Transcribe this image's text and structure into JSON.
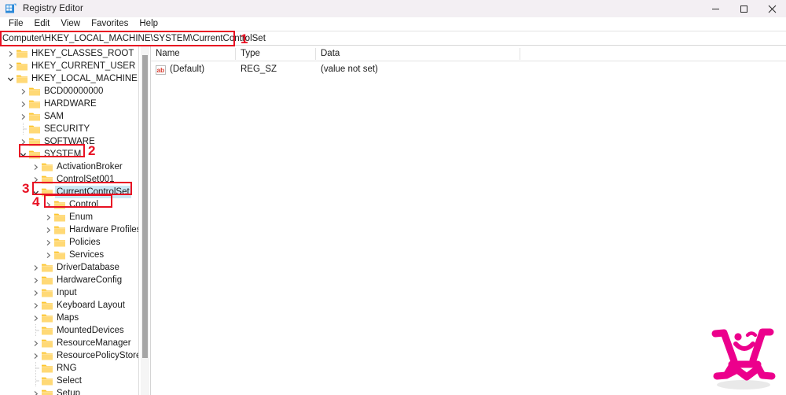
{
  "window": {
    "title": "Registry Editor",
    "icon": "registry-editor-icon",
    "controls": {
      "minimize": "minimize-icon",
      "maximize": "maximize-icon",
      "close": "close-icon"
    }
  },
  "menu": {
    "items": [
      "File",
      "Edit",
      "View",
      "Favorites",
      "Help"
    ]
  },
  "address": {
    "value": "Computer\\HKEY_LOCAL_MACHINE\\SYSTEM\\CurrentControlSet"
  },
  "tree": {
    "items": [
      {
        "label": "HKEY_CLASSES_ROOT",
        "depth": 1,
        "state": "collapsed",
        "selected": false
      },
      {
        "label": "HKEY_CURRENT_USER",
        "depth": 1,
        "state": "collapsed",
        "selected": false
      },
      {
        "label": "HKEY_LOCAL_MACHINE",
        "depth": 1,
        "state": "expanded",
        "selected": false
      },
      {
        "label": "BCD00000000",
        "depth": 2,
        "state": "collapsed",
        "selected": false
      },
      {
        "label": "HARDWARE",
        "depth": 2,
        "state": "collapsed",
        "selected": false
      },
      {
        "label": "SAM",
        "depth": 2,
        "state": "collapsed",
        "selected": false
      },
      {
        "label": "SECURITY",
        "depth": 2,
        "state": "leaf",
        "selected": false
      },
      {
        "label": "SOFTWARE",
        "depth": 2,
        "state": "collapsed",
        "selected": false
      },
      {
        "label": "SYSTEM",
        "depth": 2,
        "state": "expanded",
        "selected": false
      },
      {
        "label": "ActivationBroker",
        "depth": 3,
        "state": "collapsed",
        "selected": false
      },
      {
        "label": "ControlSet001",
        "depth": 3,
        "state": "collapsed",
        "selected": false
      },
      {
        "label": "CurrentControlSet",
        "depth": 3,
        "state": "expanded",
        "selected": true
      },
      {
        "label": "Control",
        "depth": 4,
        "state": "collapsed",
        "selected": false
      },
      {
        "label": "Enum",
        "depth": 4,
        "state": "collapsed",
        "selected": false
      },
      {
        "label": "Hardware Profiles",
        "depth": 4,
        "state": "collapsed",
        "selected": false
      },
      {
        "label": "Policies",
        "depth": 4,
        "state": "collapsed",
        "selected": false
      },
      {
        "label": "Services",
        "depth": 4,
        "state": "collapsed",
        "selected": false
      },
      {
        "label": "DriverDatabase",
        "depth": 3,
        "state": "collapsed",
        "selected": false
      },
      {
        "label": "HardwareConfig",
        "depth": 3,
        "state": "collapsed",
        "selected": false
      },
      {
        "label": "Input",
        "depth": 3,
        "state": "collapsed",
        "selected": false
      },
      {
        "label": "Keyboard Layout",
        "depth": 3,
        "state": "collapsed",
        "selected": false
      },
      {
        "label": "Maps",
        "depth": 3,
        "state": "collapsed",
        "selected": false
      },
      {
        "label": "MountedDevices",
        "depth": 3,
        "state": "leaf",
        "selected": false
      },
      {
        "label": "ResourceManager",
        "depth": 3,
        "state": "collapsed",
        "selected": false
      },
      {
        "label": "ResourcePolicyStore",
        "depth": 3,
        "state": "collapsed",
        "selected": false
      },
      {
        "label": "RNG",
        "depth": 3,
        "state": "leaf",
        "selected": false
      },
      {
        "label": "Select",
        "depth": 3,
        "state": "leaf",
        "selected": false
      },
      {
        "label": "Setup",
        "depth": 3,
        "state": "collapsed",
        "selected": false
      }
    ]
  },
  "values": {
    "columns": [
      "Name",
      "Type",
      "Data"
    ],
    "rows": [
      {
        "icon": "string-value-icon",
        "name": "(Default)",
        "type": "REG_SZ",
        "data": "(value not set)"
      }
    ]
  },
  "annotations": [
    {
      "number": "1",
      "target": "address-bar"
    },
    {
      "number": "2",
      "target": "tree-item-system"
    },
    {
      "number": "3",
      "target": "tree-item-currentcontrolset"
    },
    {
      "number": "4",
      "target": "tree-item-control"
    }
  ],
  "colors": {
    "annotation_red": "#e81123",
    "folder_yellow": "#ffd076",
    "selection_blue": "#cce8f4",
    "logo_pink": "#ec008c",
    "titlebar": "#f3eff3"
  },
  "watermark": {
    "name": "stick-figure-logo"
  }
}
